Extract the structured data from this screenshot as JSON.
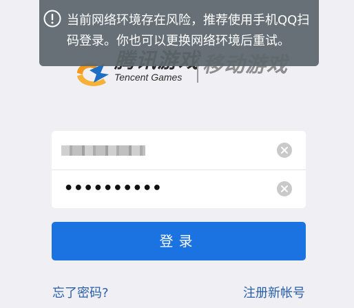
{
  "toast": {
    "icon": "exclamation-circle-icon",
    "message": "当前网络环境存在风险，推荐使用手机QQ扫码登录。你也可以更换网络环境后重试。"
  },
  "logo": {
    "tencent_cn": "腾讯游戏",
    "tencent_en": "Tencent Games",
    "mobile": "移动游戏"
  },
  "form": {
    "password_value": "••••••••••",
    "clear_icon": "clear-circle-icon"
  },
  "login_button": {
    "label": "登录"
  },
  "links": {
    "forgot_password": "忘了密码?",
    "register": "注册新帐号"
  },
  "colors": {
    "background": "#efeff4",
    "primary": "#1a73e0",
    "link": "#2a5fa8",
    "toast": "#5c666c"
  }
}
